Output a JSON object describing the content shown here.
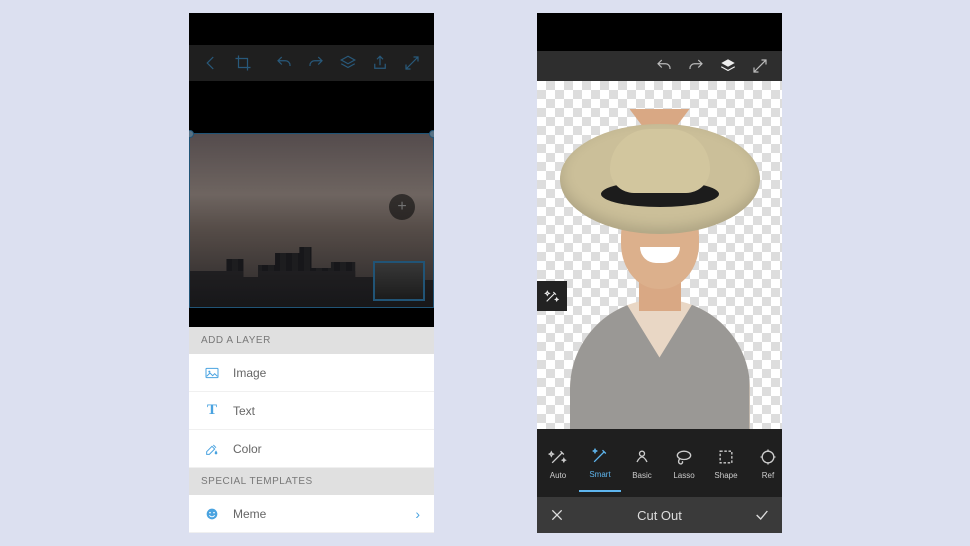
{
  "left": {
    "toolbar": {
      "back": "Back",
      "crop": "Crop",
      "undo": "Undo",
      "redo": "Redo",
      "layers": "Layers",
      "share": "Share",
      "fullscreen": "Fullscreen"
    },
    "add_button": "+",
    "panel": {
      "header1": "ADD A LAYER",
      "items": [
        {
          "icon": "image-icon",
          "label": "Image"
        },
        {
          "icon": "text-icon",
          "label": "Text"
        },
        {
          "icon": "color-icon",
          "label": "Color"
        }
      ],
      "header2": "SPECIAL TEMPLATES",
      "templates": [
        {
          "icon": "meme-icon",
          "label": "Meme"
        }
      ]
    }
  },
  "right": {
    "toolbar": {
      "undo": "Undo",
      "redo": "Redo",
      "layers": "Layers",
      "fullscreen": "Fullscreen"
    },
    "side_tool": "Magic",
    "tools": [
      {
        "label": "Auto",
        "active": false
      },
      {
        "label": "Smart",
        "active": true
      },
      {
        "label": "Basic",
        "active": false
      },
      {
        "label": "Lasso",
        "active": false
      },
      {
        "label": "Shape",
        "active": false
      },
      {
        "label": "Ref",
        "active": false
      }
    ],
    "bottom": {
      "cancel": "Cancel",
      "title": "Cut Out",
      "confirm": "Confirm"
    }
  }
}
